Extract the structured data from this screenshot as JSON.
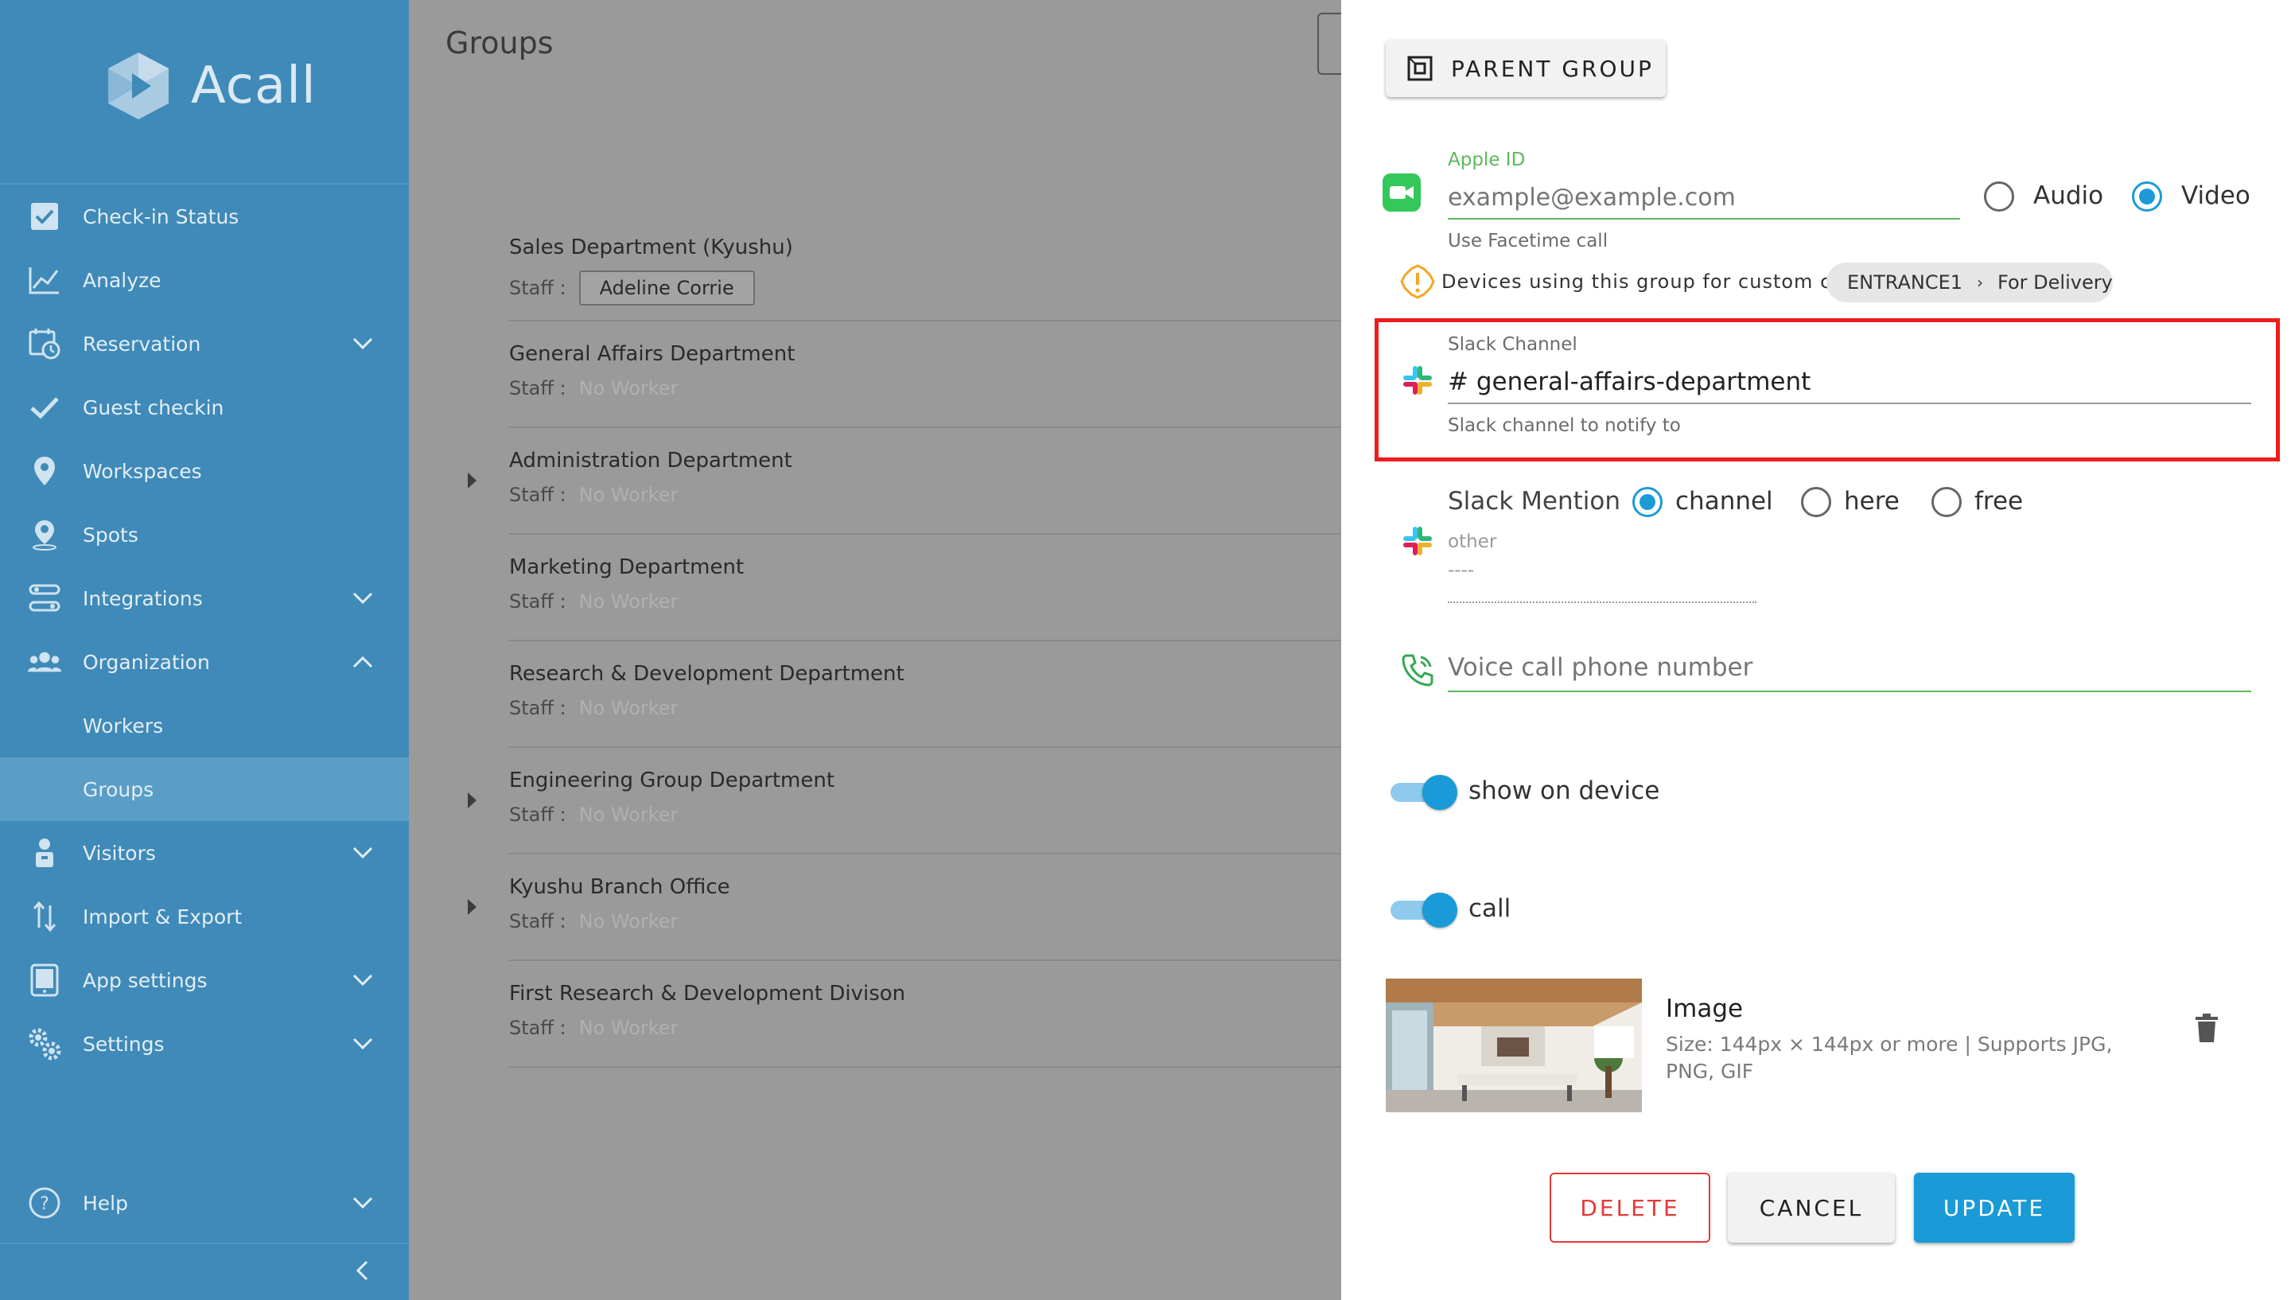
{
  "app": {
    "logo_text": "Acall"
  },
  "colors": {
    "sidebar": "#3f8ab8",
    "accent": "#1c9ad6",
    "green": "#5cb85c",
    "danger": "#e53935",
    "highlight": "#ee1c1c"
  },
  "sidebar": {
    "items": [
      {
        "label": "Check-in Status",
        "icon": "checkbox-icon"
      },
      {
        "label": "Analyze",
        "icon": "chart-line-icon"
      },
      {
        "label": "Reservation",
        "icon": "calendar-clock-icon",
        "expand": "down"
      },
      {
        "label": "Guest checkin",
        "icon": "checkmark-icon"
      },
      {
        "label": "Workspaces",
        "icon": "location-pin-icon"
      },
      {
        "label": "Spots",
        "icon": "person-pin-icon"
      },
      {
        "label": "Integrations",
        "icon": "integrations-icon",
        "expand": "down"
      },
      {
        "label": "Organization",
        "icon": "people-icon",
        "expand": "up"
      },
      {
        "label": "Workers",
        "sub": true
      },
      {
        "label": "Groups",
        "sub": true,
        "active": true
      },
      {
        "label": "Visitors",
        "icon": "visitor-icon",
        "expand": "down"
      },
      {
        "label": "Import & Export",
        "icon": "import-export-icon"
      },
      {
        "label": "App settings",
        "icon": "tablet-icon",
        "expand": "down"
      },
      {
        "label": "Settings",
        "icon": "gears-icon",
        "expand": "down"
      }
    ],
    "help_label": "Help",
    "collapse_icon": "chevron-left-icon"
  },
  "main": {
    "title": "Groups",
    "staff_label": "Staff :",
    "groups": [
      {
        "name": "Sales Department (Kyushu)",
        "staff": "Adeline Corrie",
        "has_chip": true,
        "expandable": false
      },
      {
        "name": "General Affairs Department",
        "staff": "No Worker",
        "expandable": false
      },
      {
        "name": "Administration Department",
        "staff": "No Worker",
        "expandable": true
      },
      {
        "name": "Marketing Department",
        "staff": "No Worker",
        "expandable": false
      },
      {
        "name": "Research & Development Department",
        "staff": "No Worker",
        "expandable": false
      },
      {
        "name": "Engineering Group Department",
        "staff": "No Worker",
        "expandable": true
      },
      {
        "name": "Kyushu Branch Office",
        "staff": "No Worker",
        "expandable": true
      },
      {
        "name": "First Research & Development Divison",
        "staff": "No Worker",
        "expandable": false
      }
    ]
  },
  "panel": {
    "parent_group_label": "PARENT GROUP",
    "facetime": {
      "label": "Apple ID",
      "placeholder": "example@example.com",
      "hint": "Use Facetime call",
      "audio_label": "Audio",
      "video_label": "Video",
      "selected": "Video"
    },
    "custom_call": {
      "text": "Devices using this group for custom call",
      "device": "ENTRANCE1",
      "target": "For Delivery"
    },
    "slack_channel": {
      "label": "Slack Channel",
      "value": "# general-affairs-department",
      "hint": "Slack channel to notify to"
    },
    "slack_mention": {
      "label": "Slack Mention",
      "options": [
        "channel",
        "here",
        "free"
      ],
      "selected": "channel",
      "other_label": "other",
      "other_value": "----"
    },
    "voice_call": {
      "placeholder": "Voice call phone number"
    },
    "show_on_device": {
      "label": "show on device",
      "on": true
    },
    "call": {
      "label": "call",
      "on": true
    },
    "image": {
      "title": "Image",
      "hint": "Size: 144px × 144px or more | Supports JPG, PNG, GIF"
    },
    "buttons": {
      "delete": "DELETE",
      "cancel": "CANCEL",
      "update": "UPDATE"
    }
  }
}
